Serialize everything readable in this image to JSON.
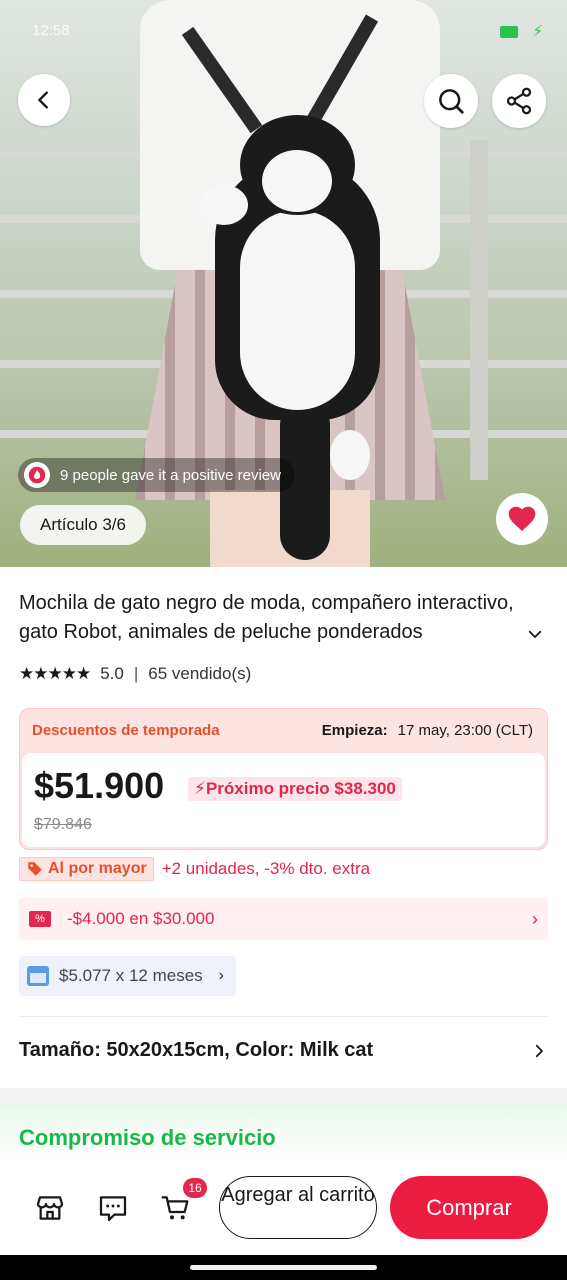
{
  "status": {
    "time": "12:58"
  },
  "hero": {
    "review_text": "9 people gave it a positive review",
    "article_counter": "Artículo 3/6"
  },
  "product": {
    "title": "Mochila de gato negro de moda, compañero interactivo, gato Robot, animales de peluche ponderados",
    "rating": "5.0",
    "sold": "65 vendido(s)"
  },
  "promo": {
    "label": "Descuentos de temporada",
    "starts_label": "Empieza:",
    "starts_value": "17 may, 23:00 (CLT)",
    "price": "$51.900",
    "next_price": "Próximo precio $38.300",
    "original_price": "$79.846"
  },
  "wholesale": {
    "badge": "Al por mayor",
    "text": "+2 unidades, -3% dto. extra"
  },
  "coupon": {
    "text": "-$4.000 en $30.000"
  },
  "installments": {
    "text": "$5.077 x 12 meses"
  },
  "variant": {
    "text": "Tamaño: 50x20x15cm, Color: Milk cat"
  },
  "service": {
    "title": "Compromiso de servicio"
  },
  "bottom": {
    "cart_count": "16",
    "add_to_cart": "Agregar al carrito",
    "buy": "Comprar"
  },
  "colors": {
    "accent": "#ec1c40",
    "promo_orange": "#e8502a",
    "service_green": "#19b84a"
  }
}
